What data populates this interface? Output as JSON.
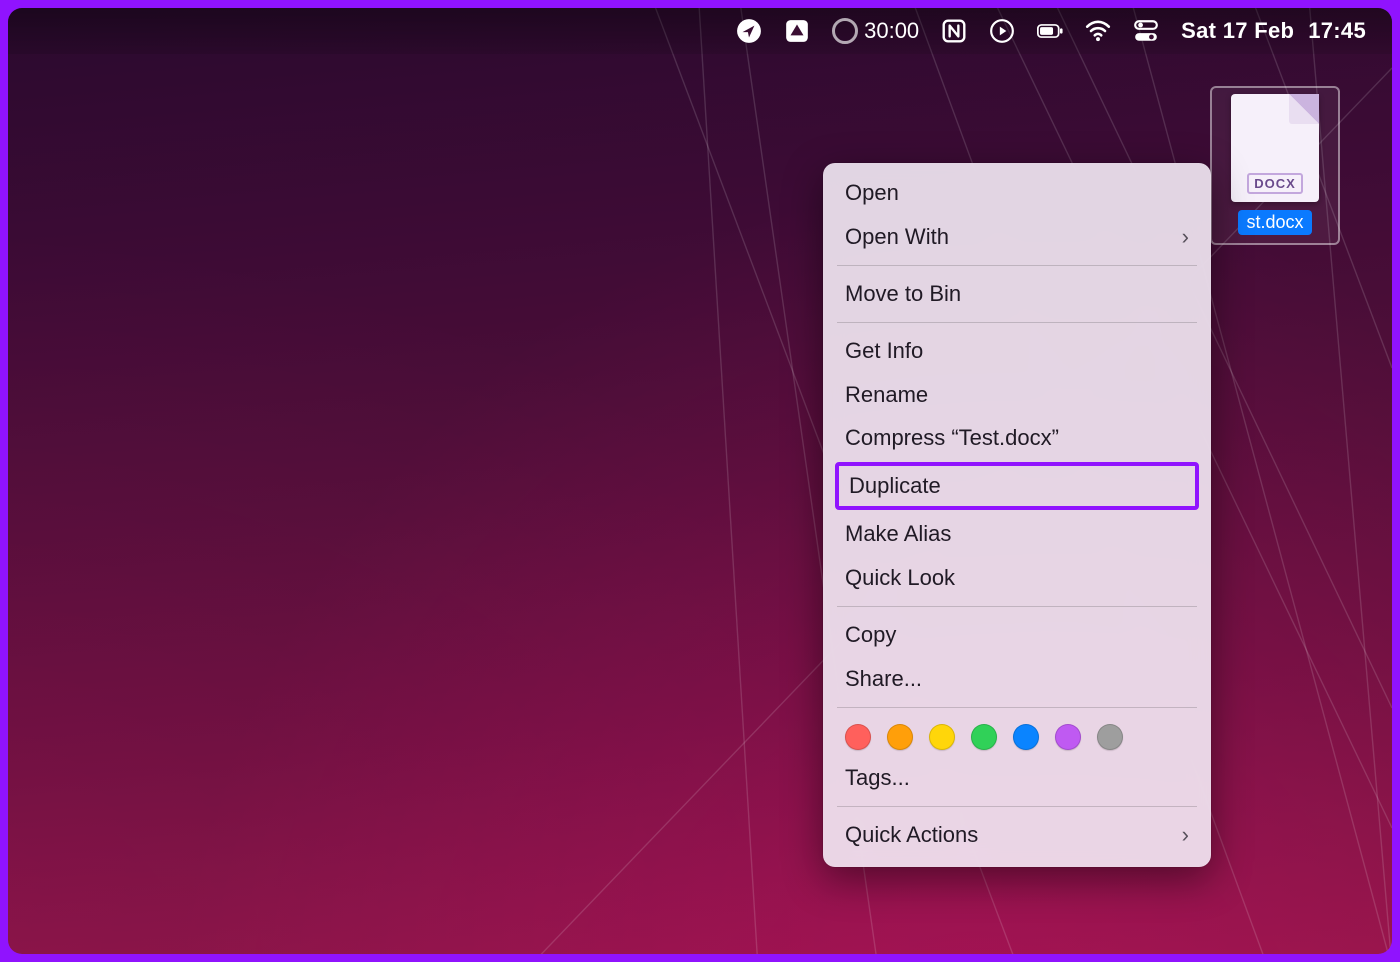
{
  "menubar": {
    "timer": "30:00",
    "date": "Sat 17 Feb",
    "time": "17:45"
  },
  "file": {
    "ext_badge": "DOCX",
    "name": "Test.docx",
    "visible_name": "st.docx"
  },
  "context_menu": {
    "open": "Open",
    "open_with": "Open With",
    "move_to_bin": "Move to Bin",
    "get_info": "Get Info",
    "rename": "Rename",
    "compress": "Compress “Test.docx”",
    "duplicate": "Duplicate",
    "make_alias": "Make Alias",
    "quick_look": "Quick Look",
    "copy": "Copy",
    "share": "Share...",
    "tags": "Tags...",
    "quick_actions": "Quick Actions",
    "tag_colors": [
      "#ff605c",
      "#ff9f0a",
      "#ffd60a",
      "#30d158",
      "#0a84ff",
      "#bf5af2",
      "#9e9e9e"
    ]
  },
  "annotation": {
    "highlight_color": "#9013fe"
  }
}
